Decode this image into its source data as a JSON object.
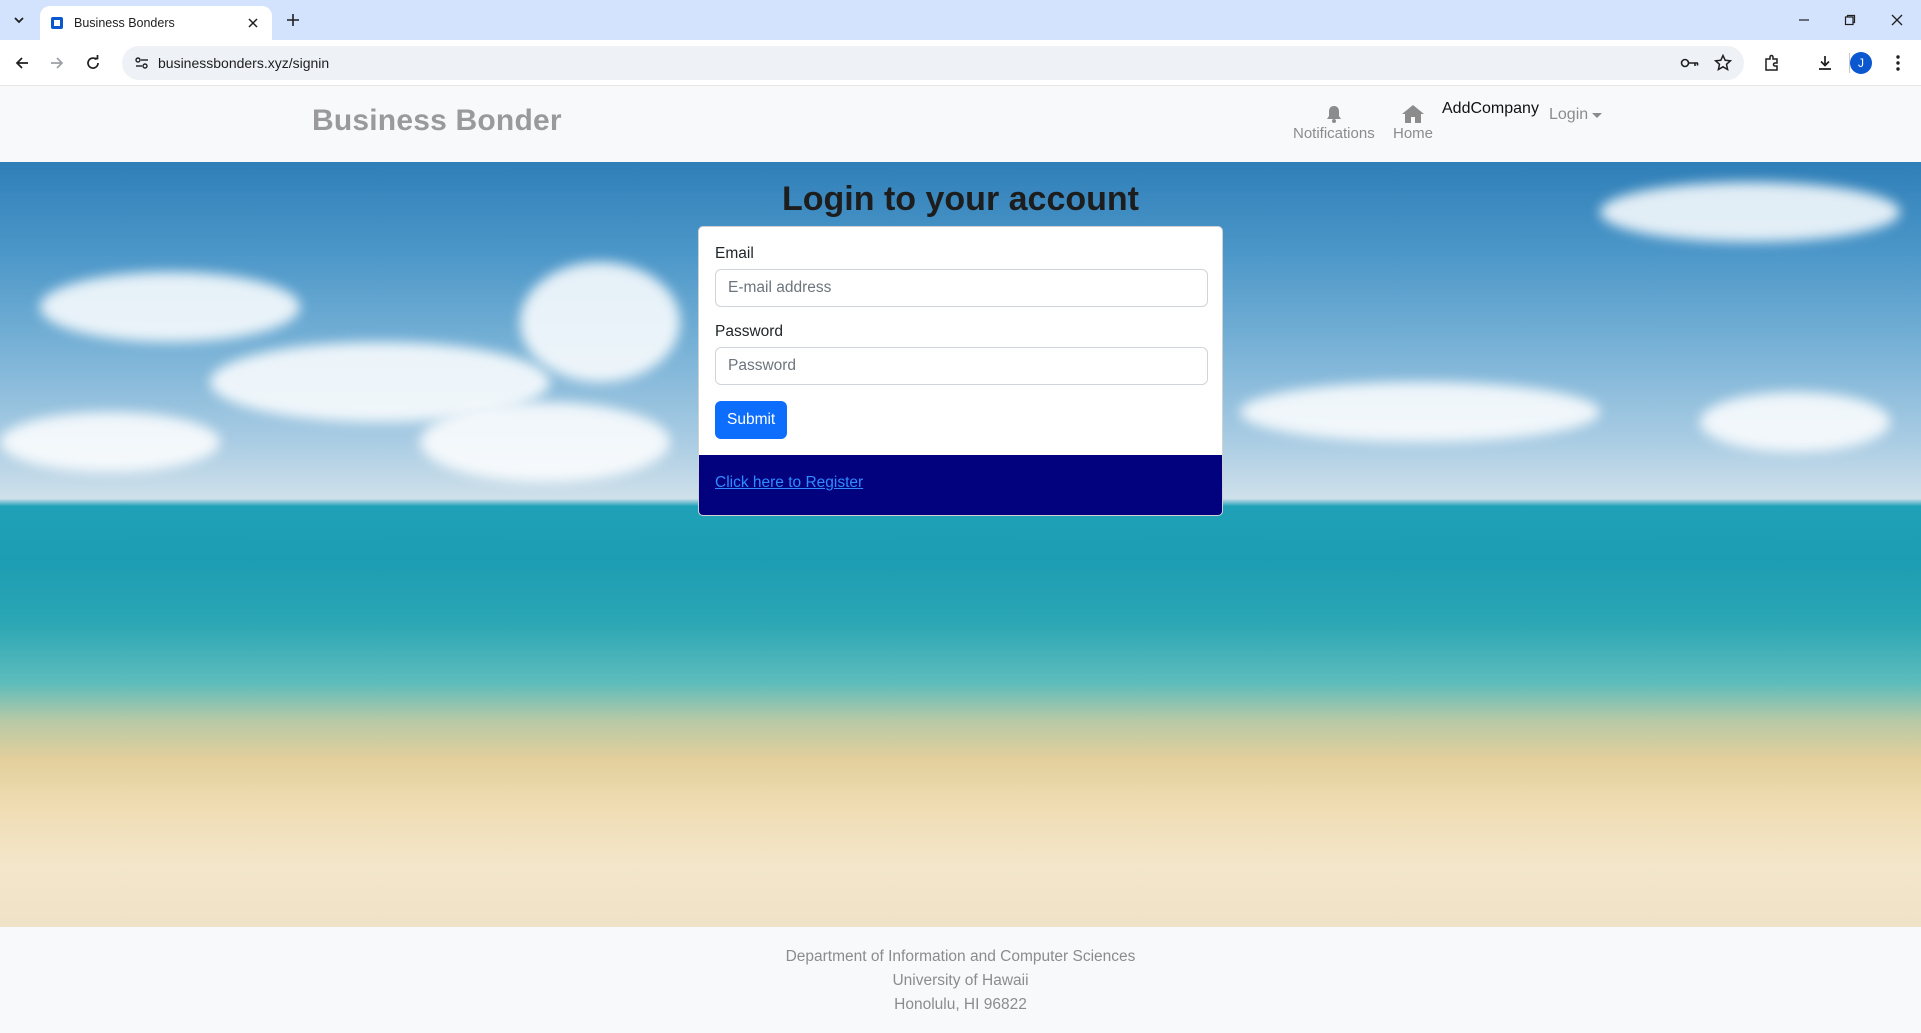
{
  "browser": {
    "tab_title": "Business Bonders",
    "url": "businessbonders.xyz/signin",
    "profile_initial": "J"
  },
  "navbar": {
    "brand": "Business Bonder",
    "notifications_label": "Notifications",
    "home_label": "Home",
    "add_company_label": "AddCompany",
    "login_label": "Login"
  },
  "main": {
    "title": "Login to your account",
    "email_label": "Email",
    "email_placeholder": "E-mail address",
    "password_label": "Password",
    "password_placeholder": "Password",
    "submit_label": "Submit",
    "register_link": "Click here to Register"
  },
  "footer": {
    "line1": "Department of Information and Computer Sciences",
    "line2": "University of Hawaii",
    "line3": "Honolulu, HI 96822"
  },
  "colors": {
    "accent": "#0d6efd",
    "register_bg": "#02027f",
    "tabstrip_bg": "#d3e3fd"
  }
}
